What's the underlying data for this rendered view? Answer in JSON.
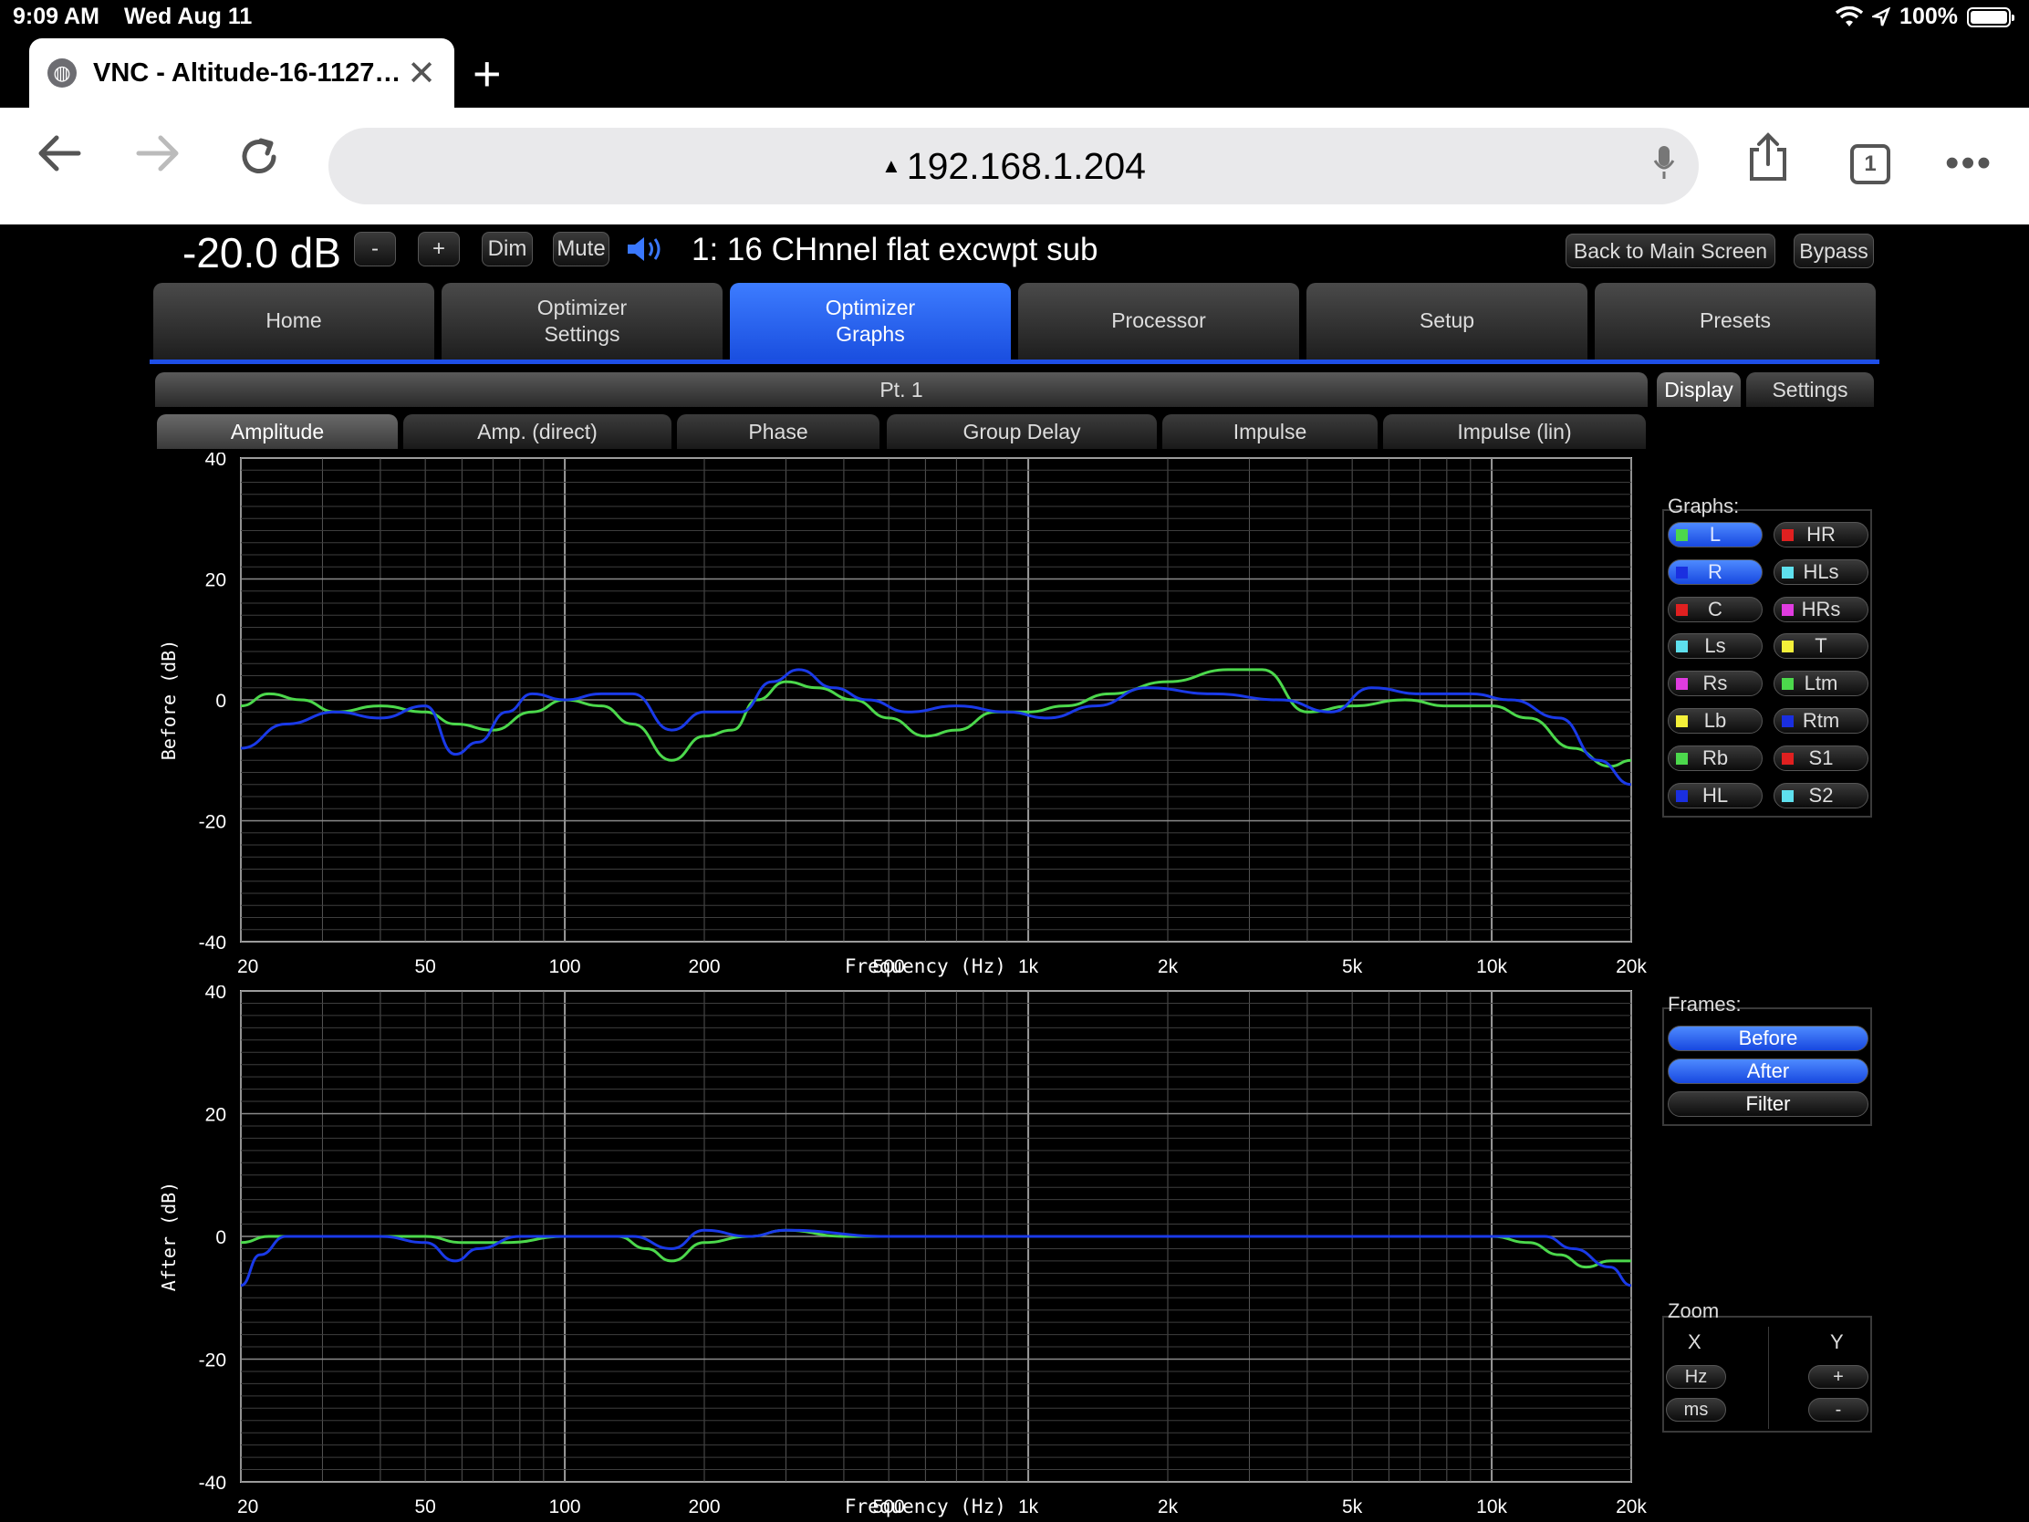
{
  "status_bar": {
    "time": "9:09 AM",
    "date": "Wed Aug 11",
    "battery": "100%"
  },
  "browser": {
    "tab_title": "VNC - Altitude-16-1127…",
    "url": "192.168.1.204",
    "tab_count": "1"
  },
  "app": {
    "volume": "-20.0 dB",
    "vol_minus": "-",
    "vol_plus": "+",
    "dim": "Dim",
    "mute": "Mute",
    "preset_title": "1: 16 CHnnel flat excwpt sub",
    "back_main": "Back to Main Screen",
    "bypass": "Bypass",
    "main_tabs": [
      {
        "line1": "Home",
        "line2": ""
      },
      {
        "line1": "Optimizer",
        "line2": "Settings"
      },
      {
        "line1": "Optimizer",
        "line2": "Graphs"
      },
      {
        "line1": "Processor",
        "line2": ""
      },
      {
        "line1": "Setup",
        "line2": ""
      },
      {
        "line1": "Presets",
        "line2": ""
      }
    ],
    "point_label": "Pt. 1",
    "graph_tabs": [
      "Amplitude",
      "Amp. (direct)",
      "Phase",
      "Group Delay",
      "Impulse",
      "Impulse (lin)"
    ],
    "right_tabs": [
      "Display",
      "Settings"
    ],
    "graphs_label": "Graphs:",
    "channels": [
      {
        "name": "L",
        "color": "#4cd84c",
        "on": true
      },
      {
        "name": "HR",
        "color": "#e02020",
        "on": false
      },
      {
        "name": "R",
        "color": "#1a2fe0",
        "on": true
      },
      {
        "name": "HLs",
        "color": "#5ee0ee",
        "on": false
      },
      {
        "name": "C",
        "color": "#e02020",
        "on": false
      },
      {
        "name": "HRs",
        "color": "#e03ce0",
        "on": false
      },
      {
        "name": "Ls",
        "color": "#5ee0ee",
        "on": false
      },
      {
        "name": "T",
        "color": "#f4f03a",
        "on": false
      },
      {
        "name": "Rs",
        "color": "#e03ce0",
        "on": false
      },
      {
        "name": "Ltm",
        "color": "#4cd84c",
        "on": false
      },
      {
        "name": "Lb",
        "color": "#f4f03a",
        "on": false
      },
      {
        "name": "Rtm",
        "color": "#1a2fe0",
        "on": false
      },
      {
        "name": "Rb",
        "color": "#4cd84c",
        "on": false
      },
      {
        "name": "S1",
        "color": "#e02020",
        "on": false
      },
      {
        "name": "HL",
        "color": "#1a2fe0",
        "on": false
      },
      {
        "name": "S2",
        "color": "#5ee0ee",
        "on": false
      }
    ],
    "frames_label": "Frames:",
    "frames": [
      {
        "name": "Before",
        "on": true
      },
      {
        "name": "After",
        "on": true
      },
      {
        "name": "Filter",
        "on": false
      }
    ],
    "zoom_label": "Zoom",
    "zoom_x": "X",
    "zoom_y": "Y",
    "zoom_hz": "Hz",
    "zoom_ms": "ms",
    "zoom_plus": "+",
    "zoom_minus": "-"
  },
  "chart_data": [
    {
      "type": "line",
      "ylabel": "Before (dB)",
      "xlabel": "Frequency (Hz)",
      "x_scale": "log",
      "xlim": [
        20,
        20000
      ],
      "ylim": [
        -40,
        40
      ],
      "x_ticks": [
        "20",
        "50",
        "100",
        "200",
        "500",
        "1k",
        "2k",
        "5k",
        "10k",
        "20k"
      ],
      "y_ticks": [
        "40",
        "20",
        "0",
        "-20",
        "-40"
      ],
      "grid": true,
      "series": [
        {
          "color": "#4cd84c",
          "points": [
            [
              20,
              -1
            ],
            [
              23,
              1
            ],
            [
              27,
              0
            ],
            [
              32,
              -2
            ],
            [
              40,
              -1
            ],
            [
              50,
              -2
            ],
            [
              58,
              -4
            ],
            [
              70,
              -5
            ],
            [
              85,
              -2
            ],
            [
              100,
              0
            ],
            [
              120,
              -1
            ],
            [
              140,
              -4
            ],
            [
              170,
              -10
            ],
            [
              200,
              -6
            ],
            [
              230,
              -5
            ],
            [
              260,
              0
            ],
            [
              300,
              3
            ],
            [
              350,
              2
            ],
            [
              420,
              0
            ],
            [
              500,
              -3
            ],
            [
              600,
              -6
            ],
            [
              700,
              -5
            ],
            [
              850,
              -2
            ],
            [
              1000,
              -2
            ],
            [
              1200,
              -1
            ],
            [
              1500,
              1
            ],
            [
              2000,
              3
            ],
            [
              2700,
              5
            ],
            [
              3200,
              5
            ],
            [
              4000,
              -2
            ],
            [
              5000,
              -1
            ],
            [
              6500,
              0
            ],
            [
              8000,
              -1
            ],
            [
              10000,
              -1
            ],
            [
              12000,
              -3
            ],
            [
              15000,
              -8
            ],
            [
              18000,
              -11
            ],
            [
              20000,
              -10
            ]
          ]
        },
        {
          "color": "#1a3ae8",
          "points": [
            [
              20,
              -8
            ],
            [
              25,
              -4
            ],
            [
              32,
              -2
            ],
            [
              40,
              -3
            ],
            [
              50,
              -1
            ],
            [
              58,
              -9
            ],
            [
              65,
              -7
            ],
            [
              75,
              -2
            ],
            [
              85,
              1
            ],
            [
              100,
              0
            ],
            [
              120,
              1
            ],
            [
              140,
              1
            ],
            [
              170,
              -5
            ],
            [
              200,
              -2
            ],
            [
              240,
              -2
            ],
            [
              280,
              3
            ],
            [
              320,
              5
            ],
            [
              380,
              2
            ],
            [
              450,
              0
            ],
            [
              550,
              -2
            ],
            [
              700,
              -1
            ],
            [
              900,
              -2
            ],
            [
              1100,
              -3
            ],
            [
              1400,
              -1
            ],
            [
              1800,
              2
            ],
            [
              2500,
              1
            ],
            [
              3500,
              0
            ],
            [
              4500,
              -2
            ],
            [
              5500,
              2
            ],
            [
              7000,
              1
            ],
            [
              9000,
              1
            ],
            [
              11000,
              0
            ],
            [
              14000,
              -3
            ],
            [
              17000,
              -10
            ],
            [
              20000,
              -14
            ]
          ]
        }
      ]
    },
    {
      "type": "line",
      "ylabel": "After (dB)",
      "xlabel": "Frequency (Hz)",
      "x_scale": "log",
      "xlim": [
        20,
        20000
      ],
      "ylim": [
        -40,
        40
      ],
      "x_ticks": [
        "20",
        "50",
        "100",
        "200",
        "500",
        "1k",
        "2k",
        "5k",
        "10k",
        "20k"
      ],
      "y_ticks": [
        "40",
        "20",
        "0",
        "-20",
        "-40"
      ],
      "grid": true,
      "series": [
        {
          "color": "#4cd84c",
          "points": [
            [
              20,
              -1
            ],
            [
              23,
              0
            ],
            [
              30,
              0
            ],
            [
              50,
              0
            ],
            [
              60,
              -1
            ],
            [
              75,
              -1
            ],
            [
              100,
              0
            ],
            [
              130,
              0
            ],
            [
              150,
              -2
            ],
            [
              170,
              -4
            ],
            [
              200,
              -1
            ],
            [
              250,
              0
            ],
            [
              300,
              1
            ],
            [
              400,
              0
            ],
            [
              600,
              0
            ],
            [
              1000,
              0
            ],
            [
              2000,
              0
            ],
            [
              5000,
              0
            ],
            [
              10000,
              0
            ],
            [
              12000,
              -1
            ],
            [
              14000,
              -3
            ],
            [
              16000,
              -5
            ],
            [
              18000,
              -4
            ],
            [
              20000,
              -4
            ]
          ]
        },
        {
          "color": "#1a3ae8",
          "points": [
            [
              20,
              -8
            ],
            [
              22,
              -3
            ],
            [
              25,
              0
            ],
            [
              40,
              0
            ],
            [
              50,
              -1
            ],
            [
              58,
              -4
            ],
            [
              65,
              -2
            ],
            [
              80,
              0
            ],
            [
              100,
              0
            ],
            [
              140,
              0
            ],
            [
              170,
              -2
            ],
            [
              200,
              1
            ],
            [
              250,
              0
            ],
            [
              300,
              1
            ],
            [
              500,
              0
            ],
            [
              1000,
              0
            ],
            [
              2000,
              0
            ],
            [
              5000,
              0
            ],
            [
              10000,
              0
            ],
            [
              13000,
              0
            ],
            [
              15000,
              -2
            ],
            [
              18000,
              -5
            ],
            [
              20000,
              -8
            ]
          ]
        }
      ]
    }
  ]
}
